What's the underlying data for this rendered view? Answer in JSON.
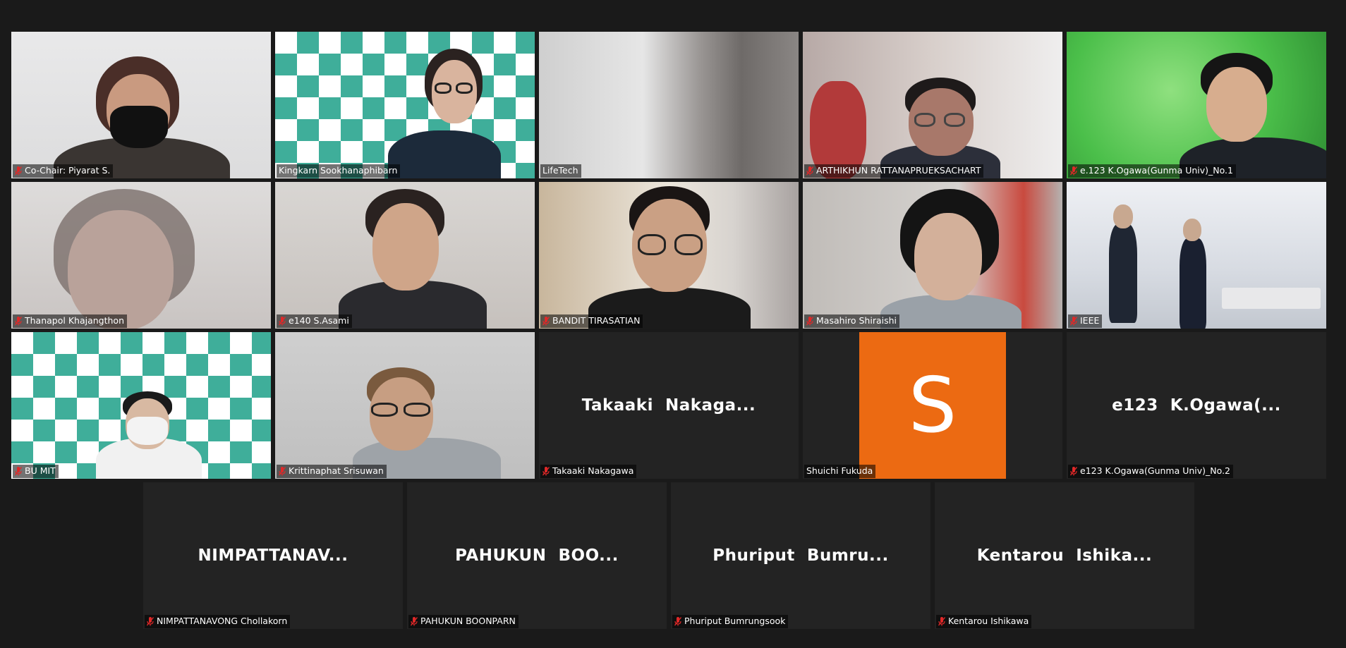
{
  "participants": [
    {
      "name": "Co-Chair: Piyarat S.",
      "muted": true
    },
    {
      "name": "Kingkarn Sookhanaphibarn",
      "muted": false
    },
    {
      "name": "LifeTech",
      "muted": false
    },
    {
      "name": "ARTHIKHUN RATTANAPRUEKSACHART",
      "muted": true
    },
    {
      "name": "e.123 K.Ogawa(Gunma Univ)_No.1",
      "muted": true
    },
    {
      "name": "Thanapol Khajangthon",
      "muted": true
    },
    {
      "name": "e140 S.Asami",
      "muted": true
    },
    {
      "name": "BANDIT TIRASATIAN",
      "muted": true
    },
    {
      "name": "Masahiro Shiraishi",
      "muted": true
    },
    {
      "name": "IEEE",
      "muted": true
    },
    {
      "name": "BU MIT",
      "muted": true
    },
    {
      "name": "Krittinaphat Srisuwan",
      "muted": true
    },
    {
      "name": "Takaaki Nakagawa",
      "muted": true,
      "display": "Takaaki  Nakaga..."
    },
    {
      "name": "Shuichi Fukuda",
      "muted": false,
      "avatar_letter": "S"
    },
    {
      "name": "e123 K.Ogawa(Gunma Univ)_No.2",
      "muted": true,
      "display": "e123  K.Ogawa(..."
    },
    {
      "name": "NIMPATTANAVONG Chollakorn",
      "muted": true,
      "display": "NIMPATTANAV..."
    },
    {
      "name": "PAHUKUN BOONPARN",
      "muted": true,
      "display": "PAHUKUN  BOO..."
    },
    {
      "name": "Phuriput Bumrungsook",
      "muted": true,
      "display": "Phuriput  Bumru..."
    },
    {
      "name": "Kentarou Ishikawa",
      "muted": true,
      "display": "Kentarou  Ishika..."
    }
  ],
  "colors": {
    "background": "#1a1a1a",
    "tile": "#232323",
    "active_speaker_border": "#d7e64a",
    "mute_icon": "#e02828",
    "avatar_bg": "#ec6a12",
    "checker_green": "#3fae9a"
  },
  "icons": {
    "mute": "microphone-muted-icon"
  }
}
